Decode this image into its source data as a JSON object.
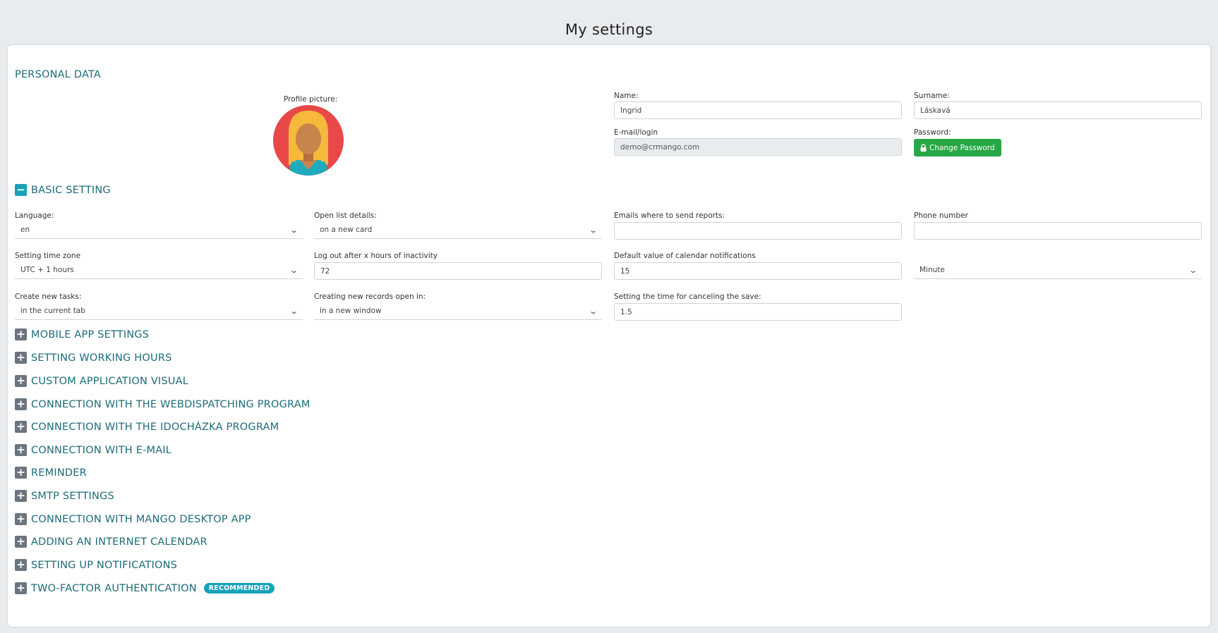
{
  "page": {
    "title": "My settings"
  },
  "personal": {
    "section_title": "PERSONAL DATA",
    "profile_label": "Profile picture:",
    "name_label": "Name:",
    "name_value": "Ingrid",
    "surname_label": "Surname:",
    "surname_value": "Láskavá",
    "email_label": "E-mail/login",
    "email_value": "demo@crmango.com",
    "password_label": "Password:",
    "change_password": "Change Password"
  },
  "basic": {
    "toggle": "−",
    "title": "BASIC SETTING",
    "language_label": "Language:",
    "language_value": "en",
    "open_list_label": "Open list details:",
    "open_list_value": "on a new card",
    "emails_label": "Emails where to send reports:",
    "emails_value": "",
    "phone_label": "Phone number",
    "phone_value": "",
    "timezone_label": "Setting time zone",
    "timezone_value": "UTC + 1 hours",
    "logout_label": "Log out after x hours of inactivity",
    "logout_value": "72",
    "calendar_label": "Default value of calendar notifications",
    "calendar_value": "15",
    "unit_value": "Minute",
    "tasks_label": "Create new tasks:",
    "tasks_value": "in the current tab",
    "records_label": "Creating new records open in:",
    "records_value": "in a new window",
    "cancel_label": "Setting the time for canceling the save:",
    "cancel_value": "1.5"
  },
  "sections": [
    {
      "toggle": "+",
      "label": "MOBILE APP SETTINGS"
    },
    {
      "toggle": "+",
      "label": "SETTING WORKING HOURS"
    },
    {
      "toggle": "+",
      "label": "CUSTOM APPLICATION VISUAL"
    },
    {
      "toggle": "+",
      "label": "CONNECTION WITH THE WEBDISPATCHING PROGRAM"
    },
    {
      "toggle": "+",
      "label": "CONNECTION WITH THE IDOCHÁZKA PROGRAM"
    },
    {
      "toggle": "+",
      "label": "CONNECTION WITH E-MAIL"
    },
    {
      "toggle": "+",
      "label": "REMINDER"
    },
    {
      "toggle": "+",
      "label": "SMTP SETTINGS"
    },
    {
      "toggle": "+",
      "label": "CONNECTION WITH MANGO DESKTOP APP"
    },
    {
      "toggle": "+",
      "label": "ADDING AN INTERNET CALENDAR"
    },
    {
      "toggle": "+",
      "label": "SETTING UP NOTIFICATIONS"
    },
    {
      "toggle": "+",
      "label": "TWO-FACTOR AUTHENTICATION",
      "badge": "RECOMMENDED"
    }
  ],
  "colors": {
    "accent": "#1d6b7a",
    "primary_button": "#28a745",
    "badge": "#17a2b8"
  },
  "icons": {
    "lock": "lock-icon",
    "chevron": "chevron-down-icon",
    "avatar": "avatar"
  }
}
